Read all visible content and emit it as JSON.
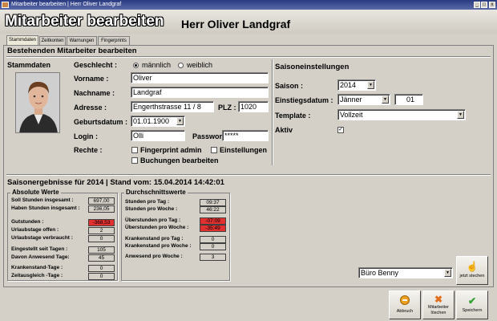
{
  "window": {
    "title": "Mitarbeiter bearbeiten | Herr Oliver Landgraf",
    "minimize": "_",
    "maximize": "□",
    "close": "x"
  },
  "header": {
    "title": "Mitarbeiter bearbeiten",
    "name": "Herr  Oliver Landgraf"
  },
  "tabs": [
    {
      "label": "Stammdaten"
    },
    {
      "label": "Zeitkonten"
    },
    {
      "label": "Warnungen"
    },
    {
      "label": "Fingerprints"
    }
  ],
  "section_title": "Bestehenden Mitarbeiter bearbeiten",
  "stammdaten": {
    "heading": "Stammdaten",
    "geschlecht_label": "Geschlecht :",
    "opt_m": "männlich",
    "opt_w": "weiblich",
    "vorname_label": "Vorname :",
    "vorname": "Oliver",
    "nachname_label": "Nachname :",
    "nachname": "Landgraf",
    "adresse_label": "Adresse :",
    "adresse": "Engerthstrasse 11 / 8",
    "plz_label": "PLZ :",
    "plz": "1020",
    "geburt_label": "Geburtsdatum :",
    "geburt": "01.01.1900",
    "login_label": "Login :",
    "login": "Olli",
    "passwort_label": "Passwort :",
    "passwort": "*****",
    "rechte_label": "Rechte :",
    "r_fingerprint": "Fingerprint admin",
    "r_einstellungen": "Einstellungen",
    "r_buchungen": "Buchungen bearbeiten"
  },
  "saison": {
    "heading": "Saisoneinstellungen",
    "saison_label": "Saison :",
    "saison": "2014",
    "einstieg_label": "Einstiegsdatum :",
    "monat": "Jänner",
    "tag": "01",
    "template_label": "Template :",
    "template": "Vollzeit",
    "aktiv_label": "Aktiv",
    "aktiv_check": "✓"
  },
  "ergebnisse": {
    "heading": "Saisonergebnisse für 2014 | Stand vom: 15.04.2014 14:42:01",
    "absolute": {
      "title": "Absolute Werte",
      "rows": [
        {
          "label": "Soll Stunden insgesamt :",
          "value": "697,00"
        },
        {
          "label": "Haben Stunden insgesamt :",
          "value": "236,05"
        },
        {
          "label": "Gutstunden :",
          "value": "-368,53"
        },
        {
          "label": "Urlaubstage offen :",
          "value": "2"
        },
        {
          "label": "Urlaubstage verbraucht :",
          "value": "0"
        },
        {
          "label": "Eingestellt seit Tagen :",
          "value": "105"
        },
        {
          "label": "Davon Anwesend Tage:",
          "value": "45"
        },
        {
          "label": "Krankenstand-Tage :",
          "value": "0"
        },
        {
          "label": "Zeitausgleich -Tage :",
          "value": "0"
        }
      ]
    },
    "durchschnitt": {
      "title": "Durchschnittswerte",
      "rows": [
        {
          "label": "Stunden pro Tag :",
          "value": "09:37"
        },
        {
          "label": "Stunden pro Woche :",
          "value": "46:22"
        },
        {
          "label": "Überstunden pro Tag :",
          "value": "-07:09"
        },
        {
          "label": "Überstunden pro Woche :",
          "value": "-35:49"
        },
        {
          "label": "Krankenstand pro Tag :",
          "value": "0"
        },
        {
          "label": "Krankenstand pro Woche :",
          "value": "0"
        },
        {
          "label": "Anwesend pro Woche :",
          "value": "3"
        }
      ]
    }
  },
  "stamp": {
    "selected": "Büro Benny",
    "button": "jetzt stechen"
  },
  "footer": {
    "abbruch": "Abbruch",
    "loeschen": "Mitarbeiter löschen",
    "speichern": "Speichern"
  },
  "colors": {
    "negative": "#e03030",
    "titlebar": "#2a3a80"
  }
}
